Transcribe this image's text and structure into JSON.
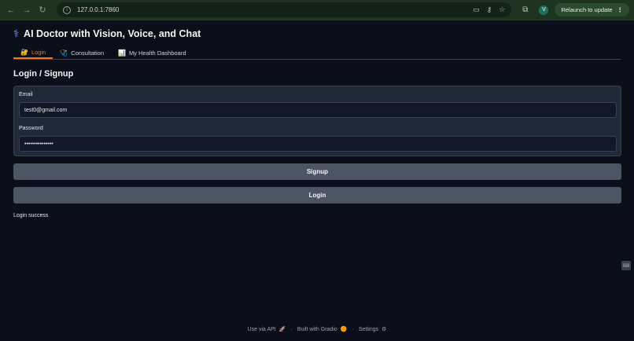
{
  "browser": {
    "url": "127.0.0.1:7860",
    "profile_initial": "V",
    "relaunch_label": "Relaunch to update",
    "relaunch_menu": "⋮"
  },
  "app": {
    "title": "AI Doctor with Vision, Voice, and Chat",
    "tabs": [
      {
        "label": "Login",
        "icon": "🔐"
      },
      {
        "label": "Consultation",
        "icon": "🩺"
      },
      {
        "label": "My Health Dashboard",
        "icon": "📊"
      }
    ],
    "section_title": "Login / Signup",
    "email": {
      "label": "Email",
      "value": "test0@gmail.com"
    },
    "password": {
      "label": "Password",
      "value": "•••••••••••••••"
    },
    "signup_label": "Signup",
    "login_label": "Login",
    "status": "Login success"
  },
  "footer": {
    "api": "Use via API",
    "gradio": "Built with Gradio",
    "settings": "Settings",
    "sep": "·"
  },
  "colors": {
    "accent": "#f97316",
    "background": "#0b0f19",
    "button": "#4b5563"
  }
}
